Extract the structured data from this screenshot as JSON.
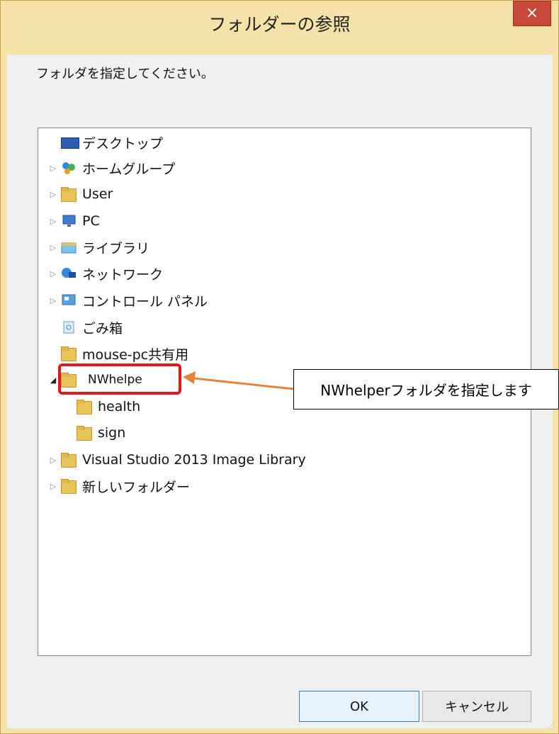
{
  "window": {
    "title": "フォルダーの参照",
    "close_glyph": "×",
    "prompt": "フォルダを指定してください。"
  },
  "tree": {
    "items": [
      {
        "label": "デスクトップ",
        "expander": "",
        "icon": "desktop-icon"
      },
      {
        "label": "ホームグループ",
        "expander": "▷",
        "icon": "homegroup-icon"
      },
      {
        "label": "User",
        "expander": "▷",
        "icon": "user-folder-icon"
      },
      {
        "label": "PC",
        "expander": "▷",
        "icon": "pc-icon"
      },
      {
        "label": "ライブラリ",
        "expander": "▷",
        "icon": "library-icon"
      },
      {
        "label": "ネットワーク",
        "expander": "▷",
        "icon": "network-icon"
      },
      {
        "label": "コントロール パネル",
        "expander": "▷",
        "icon": "control-panel-icon"
      },
      {
        "label": "ごみ箱",
        "expander": "",
        "icon": "recycle-bin-icon"
      },
      {
        "label": "mouse-pc共有用",
        "expander": "",
        "icon": "folder-icon"
      },
      {
        "label": "NWhelpe",
        "expander": "◢",
        "icon": "folder-icon"
      },
      {
        "label": "health",
        "expander": "",
        "icon": "folder-icon"
      },
      {
        "label": "sign",
        "expander": "",
        "icon": "folder-icon"
      },
      {
        "label": "Visual Studio 2013 Image Library",
        "expander": "▷",
        "icon": "folder-icon"
      },
      {
        "label": "新しいフォルダー",
        "expander": "▷",
        "icon": "folder-icon"
      }
    ]
  },
  "annotation": {
    "callout_text": "NWhelperフォルダを指定します"
  },
  "buttons": {
    "ok": "OK",
    "cancel": "キャンセル"
  },
  "colors": {
    "frame": "#f4e2a8",
    "close": "#c7473b",
    "highlight": "#e3161c",
    "arrow": "#e8823a"
  }
}
